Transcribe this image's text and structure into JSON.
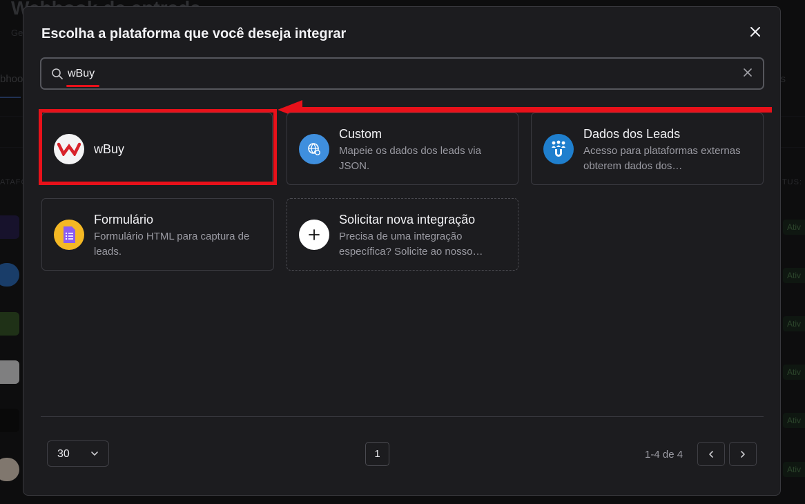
{
  "background": {
    "title": "Webhook de entrada",
    "subtitle": "Ge",
    "tab_left": "bhoo",
    "tab_right": "s",
    "column_left": "ATAFO",
    "column_right": "TUS:",
    "badge": "Ativ"
  },
  "modal": {
    "title": "Escolha a plataforma que você deseja integrar",
    "search": {
      "value": "wBuy",
      "placeholder": ""
    },
    "cards": [
      {
        "title": "wBuy",
        "description": "",
        "icon": "wbuy-logo-icon"
      },
      {
        "title": "Custom",
        "description": "Mapeie os dados dos leads via JSON.",
        "icon": "globe-gear-icon"
      },
      {
        "title": "Dados dos Leads",
        "description": "Acesso para plataformas externas obterem dados dos…",
        "icon": "people-magnet-icon"
      },
      {
        "title": "Formulário",
        "description": "Formulário HTML para captura de leads.",
        "icon": "form-document-icon"
      },
      {
        "title": "Solicitar nova integração",
        "description": "Precisa de uma integração específica? Solicite ao nosso…",
        "icon": "plus-icon"
      }
    ],
    "pagination": {
      "page_size": "30",
      "current_page": "1",
      "range": "1-4 de 4"
    }
  },
  "colors": {
    "annotation_red": "#e8111a",
    "custom_blue": "#3f8fde",
    "leads_blue": "#1f7fce",
    "form_yellow": "#f4b824",
    "form_purple": "#8a5cf0"
  }
}
